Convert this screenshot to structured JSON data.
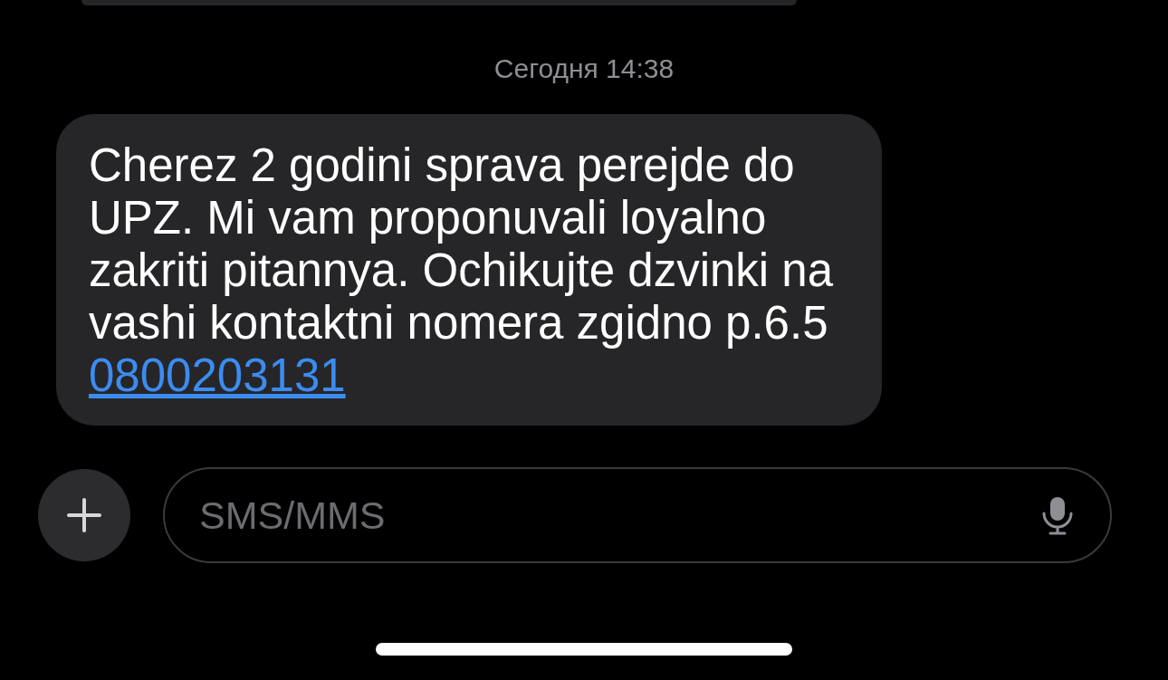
{
  "timestamp": "Сегодня 14:38",
  "message": {
    "text": "Cherez 2 godini sprava perejde do UPZ. Mi vam proponuvali loyalno zakriti pitannya. Ochikujte dzvinki na vashi kontaktni nomera zgidno p.6.5",
    "link": "0800203131"
  },
  "composer": {
    "placeholder": "SMS/MMS"
  }
}
